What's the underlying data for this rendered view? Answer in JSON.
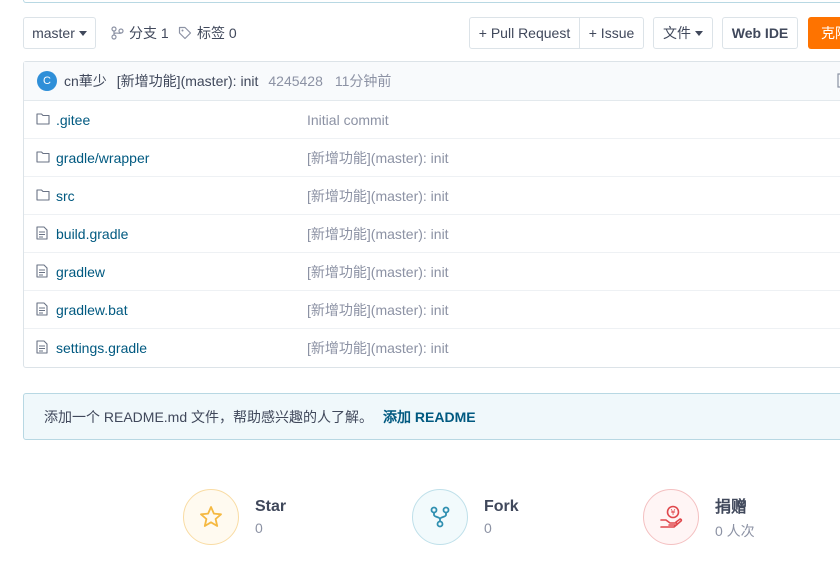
{
  "toolbar": {
    "branch": "master",
    "branches_label": "分支 1",
    "tags_label": "标签 0",
    "pull_request_label": "+ Pull Request",
    "issue_label": "+ Issue",
    "file_label": "文件",
    "webide_label": "Web IDE",
    "clone_label": "克隆"
  },
  "commit": {
    "avatar_initial": "C",
    "author": "cn華少",
    "message": "[新增功能](master): init",
    "sha": "4245428",
    "time": "11分钟前"
  },
  "files": [
    {
      "name": ".gitee",
      "type": "folder",
      "message": "Initial commit"
    },
    {
      "name": "gradle/wrapper",
      "type": "folder",
      "message": "[新增功能](master): init"
    },
    {
      "name": "src",
      "type": "folder",
      "message": "[新增功能](master): init"
    },
    {
      "name": "build.gradle",
      "type": "file",
      "message": "[新增功能](master): init"
    },
    {
      "name": "gradlew",
      "type": "file",
      "message": "[新增功能](master): init"
    },
    {
      "name": "gradlew.bat",
      "type": "file",
      "message": "[新增功能](master): init"
    },
    {
      "name": "settings.gradle",
      "type": "file",
      "message": "[新增功能](master): init"
    }
  ],
  "readme_notice": {
    "text": "添加一个 README.md 文件，帮助感兴趣的人了解。",
    "action": "添加 README"
  },
  "stats": {
    "star": {
      "label": "Star",
      "count": "0",
      "icon": "star-icon",
      "color": "#f5b942"
    },
    "fork": {
      "label": "Fork",
      "count": "0",
      "icon": "fork-icon",
      "color": "#2f8fb0"
    },
    "donate": {
      "label": "捐赠",
      "count": "0 人次",
      "icon": "donate-icon",
      "color": "#e0474c"
    }
  },
  "colors": {
    "link": "#005980",
    "muted": "#8c92a4",
    "clone_bg": "#fe7300",
    "notice_bg": "#f0f8fb"
  }
}
